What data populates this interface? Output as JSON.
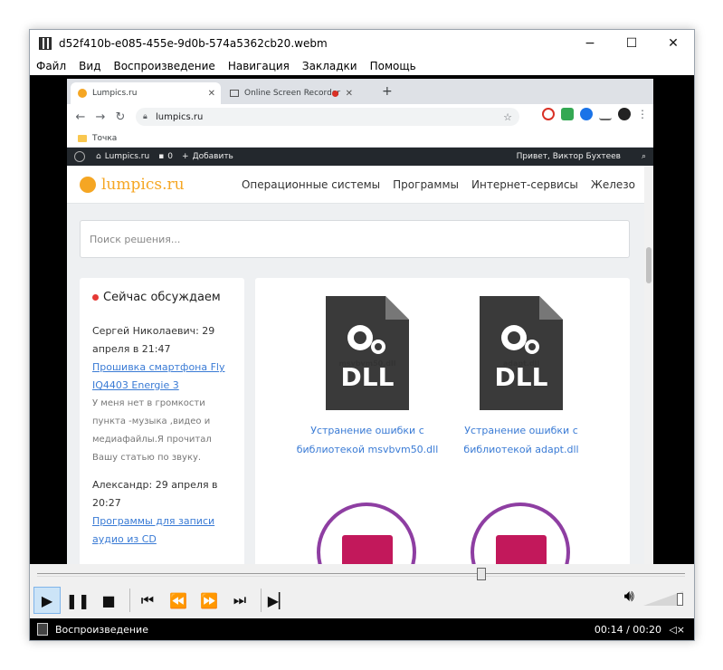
{
  "window": {
    "title": "d52f410b-e085-455e-9d0b-574a5362cb20.webm",
    "minimize": "−",
    "maximize": "☐",
    "close": "✕"
  },
  "menu": [
    "Файл",
    "Вид",
    "Воспроизведение",
    "Навигация",
    "Закладки",
    "Помощь"
  ],
  "browser": {
    "tabs": [
      {
        "label": "Lumpics.ru",
        "active": true
      },
      {
        "label": "Online Screen Recorder",
        "active": false
      }
    ],
    "new_tab": "+",
    "url": "lumpics.ru",
    "bookmark": "Точка",
    "wp_bar": {
      "site": "Lumpics.ru",
      "comments": "0",
      "add": "Добавить",
      "greeting": "Привет, Виктор Бухтеев"
    }
  },
  "site": {
    "logo": "lumpics.ru",
    "nav": [
      "Операционные системы",
      "Программы",
      "Интернет-сервисы",
      "Железо"
    ],
    "search_placeholder": "Поиск решения...",
    "sidebar": {
      "title": "Сейчас обсуждаем",
      "comments": [
        {
          "author": "Сергей Николаевич: 29 апреля в 21:47",
          "link": "Прошивка смартфона Fly IQ4403 Energie 3",
          "text": "У меня нет в громкости пункта -музыка ,видео и медиафайлы.Я прочитал Вашу статью по звуку."
        },
        {
          "author": "Александр: 29 апреля в 20:27",
          "link": "Программы для записи аудио из CD",
          "text": ""
        }
      ]
    },
    "cards": [
      {
        "file": "msvbvm50.dll",
        "badge": "DLL",
        "title": "Устранение ошибки с библиотекой msvbvm50.dll"
      },
      {
        "file": "adapt.dll",
        "badge": "DLL",
        "title": "Устранение ошибки с библиотекой adapt.dll"
      }
    ]
  },
  "player": {
    "progress": 0.7,
    "volume": 1.0,
    "status": "Воспроизведение",
    "time": "00:14 / 00:20",
    "colors": {
      "accent": "#cce4f7",
      "brand": "#f5a623",
      "dll": "#3a3a3a",
      "purple": "#8e3ea2"
    }
  }
}
